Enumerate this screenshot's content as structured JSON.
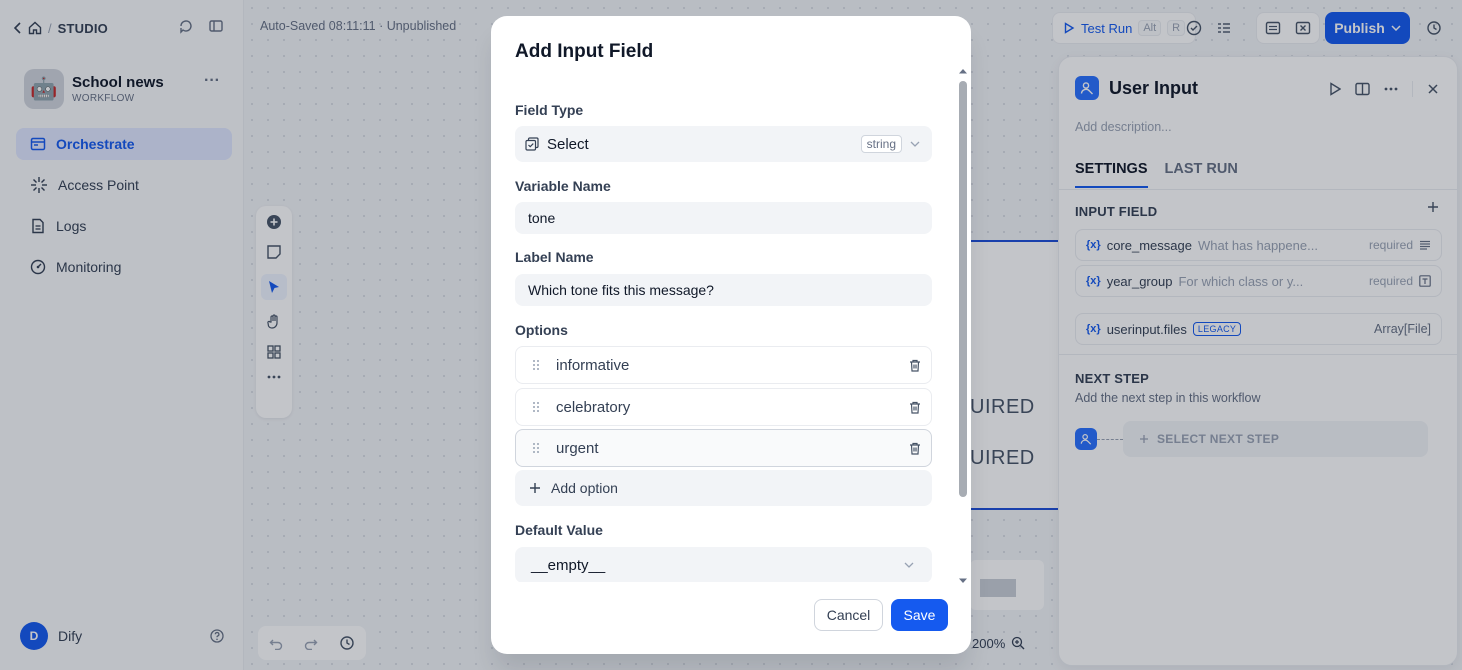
{
  "nav": {
    "studio": "STUDIO",
    "app_name": "School news",
    "app_type": "WORKFLOW",
    "app_emoji": "🤖",
    "items": [
      {
        "label": "Orchestrate",
        "active": true
      },
      {
        "label": "Access Point"
      },
      {
        "label": "Logs"
      },
      {
        "label": "Monitoring"
      }
    ],
    "user_initial": "D",
    "user_name": "Dify"
  },
  "toolbar": {
    "autosave": "Auto-Saved 08:11:11 · Unpublished",
    "test_run": "Test Run",
    "shortcut_alt": "Alt",
    "shortcut_r": "R",
    "publish": "Publish",
    "zoom": "200%"
  },
  "canvas": {
    "bg_required_1": "UIRED",
    "bg_required_2": "UIRED"
  },
  "panel": {
    "title": "User Input",
    "description_placeholder": "Add description...",
    "tabs": [
      "SETTINGS",
      "LAST RUN"
    ],
    "input_field_title": "INPUT FIELD",
    "variables": [
      {
        "name": "core_message",
        "desc": "What has happene...",
        "required": "required",
        "icon": "paragraph-icon"
      },
      {
        "name": "year_group",
        "desc": "For which class or y...",
        "required": "required",
        "icon": "text-input-icon"
      }
    ],
    "files_var": {
      "name": "userinput.files",
      "badge": "LEGACY",
      "type": "Array[File]"
    },
    "next_step_title": "NEXT STEP",
    "next_step_desc": "Add the next step in this workflow",
    "select_next_step": "SELECT NEXT STEP"
  },
  "modal": {
    "title": "Add Input Field",
    "field_type_label": "Field Type",
    "field_type_value": "Select",
    "field_type_tag": "string",
    "variable_name_label": "Variable Name",
    "variable_name_value": "tone",
    "label_name_label": "Label Name",
    "label_name_value": "Which tone fits this message?",
    "options_label": "Options",
    "options": [
      "informative",
      "celebratory",
      "urgent"
    ],
    "add_option": "Add option",
    "default_value_label": "Default Value",
    "default_value": "__empty__",
    "cancel": "Cancel",
    "save": "Save"
  },
  "colors": {
    "primary": "#155aef",
    "node_blue": "#2970ff"
  }
}
